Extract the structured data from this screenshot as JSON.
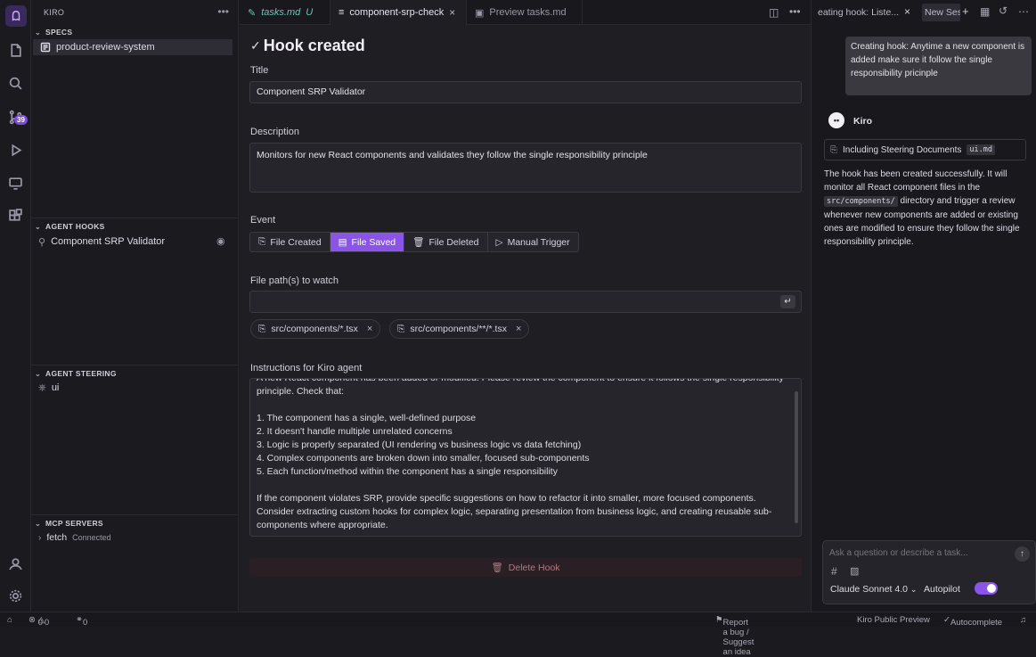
{
  "app": {
    "title": "KIRO"
  },
  "activity": {
    "source_control_badge": "39"
  },
  "sidebar": {
    "specs_header": "SPECS",
    "specs_item": "product-review-system",
    "hooks_header": "AGENT HOOKS",
    "hooks_item": "Component SRP Validator",
    "steering_header": "AGENT STEERING",
    "steering_item": "ui",
    "mcp_header": "MCP SERVERS",
    "mcp_item": "fetch",
    "mcp_status": "Connected"
  },
  "tabs": [
    {
      "label": "tasks.md",
      "suffix": "U"
    },
    {
      "label": "component-srp-check"
    },
    {
      "label": "Preview tasks.md"
    }
  ],
  "editor": {
    "heading": "Hook created",
    "title_label": "Title",
    "title_value": "Component SRP Validator",
    "description_label": "Description",
    "description_value": "Monitors for new React components and validates they follow the single responsibility principle",
    "event_label": "Event",
    "events": [
      "File Created",
      "File Saved",
      "File Deleted",
      "Manual Trigger"
    ],
    "active_event": "File Saved",
    "paths_label": "File path(s) to watch",
    "paths": [
      "src/components/*.tsx",
      "src/components/**/*.tsx"
    ],
    "instructions_label": "Instructions for Kiro agent",
    "instructions_lines": [
      "A new React component has been added or modified. Please review the component to ensure it follows the single responsibility",
      "principle. Check that:",
      "",
      "1. The component has a single, well-defined purpose",
      "2. It doesn't handle multiple unrelated concerns",
      "3. Logic is properly separated (UI rendering vs business logic vs data fetching)",
      "4. Complex components are broken down into smaller, focused sub-components",
      "5. Each function/method within the component has a single responsibility",
      "",
      "If the component violates SRP, provide specific suggestions on how to refactor it into smaller, more focused components.",
      "Consider extracting custom hooks for complex logic, separating presentation from business logic, and creating reusable sub-",
      "components where appropriate."
    ],
    "delete_label": "Delete Hook"
  },
  "chat": {
    "tab_label": "eating hook: Liste...",
    "new_session_label": "New Ses",
    "user_message": "Creating hook: Anytime a new component is added make sure it follow the single responsibility pricinple",
    "agent_name": "Kiro",
    "steering_label": "Including Steering Documents",
    "steering_file": "ui.md",
    "reply_pre": "The hook has been created successfully. It will monitor all React component files in the",
    "reply_code": "src/components/",
    "reply_post": "directory and trigger a review whenever new components are added or existing ones are modified to ensure they follow the single responsibility principle.",
    "input_placeholder": "Ask a question or describe a task...",
    "model": "Claude Sonnet 4.0",
    "autopilot_label": "Autopilot",
    "autopilot_on": true
  },
  "status": {
    "errors": "0",
    "warnings": "0",
    "ports": "0",
    "report": "Report a bug / Suggest an idea",
    "preview": "Kiro Public Preview",
    "autocomplete": "Autocomplete"
  },
  "colors": {
    "accent": "#8a55e6",
    "bg": "#1f1e23"
  }
}
